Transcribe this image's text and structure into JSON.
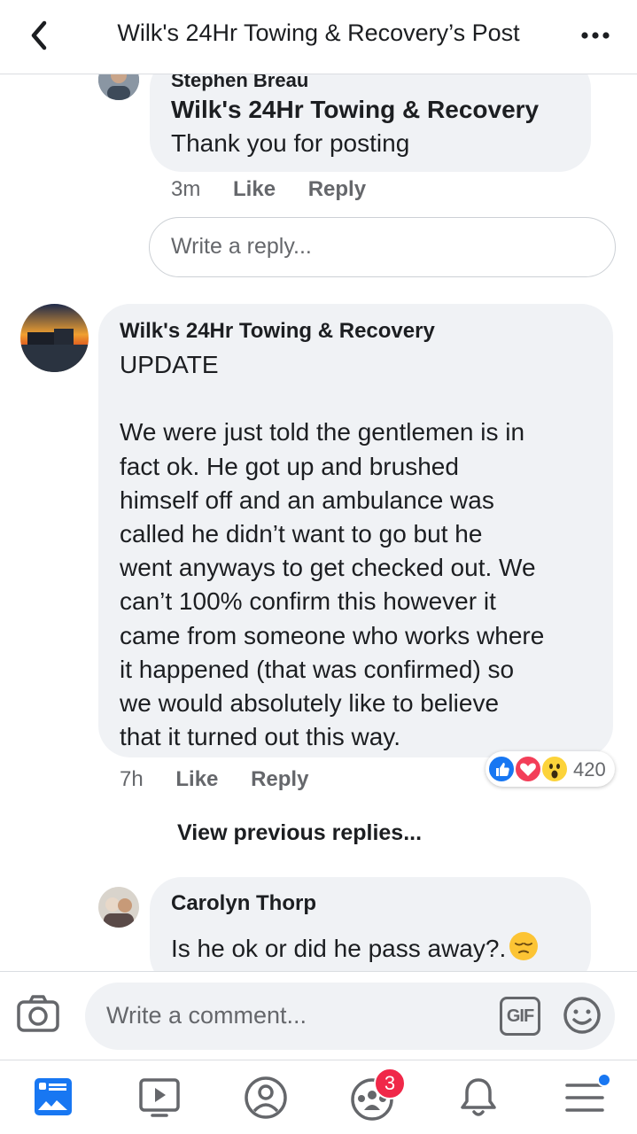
{
  "header": {
    "title": "Wilk's 24Hr Towing & Recovery’s Post",
    "back_icon": "chevron-left-icon",
    "more_icon": "more-horizontal-icon"
  },
  "comments": [
    {
      "author": "Stephen Breau",
      "mention": "Wilk's 24Hr Towing & Recovery",
      "text": "Thank you for posting",
      "time": "3m",
      "like_label": "Like",
      "reply_label": "Reply"
    },
    {
      "author": "Wilk's 24Hr Towing & Recovery",
      "text_lines": [
        "UPDATE",
        "",
        "We were just told the gentlemen is in",
        "fact ok. He got up and brushed",
        "himself off and an ambulance was",
        "called he didn’t want to go but he",
        "went anyways to get checked out. We",
        "can’t 100% confirm this however it",
        "came from someone who works where",
        "it happened (that was confirmed) so",
        "we would absolutely like to believe",
        "that it turned out this way."
      ],
      "time": "7h",
      "like_label": "Like",
      "reply_label": "Reply",
      "reactions": {
        "icons": [
          "like-reaction-icon",
          "love-reaction-icon",
          "wow-reaction-icon"
        ],
        "count": "420"
      }
    },
    {
      "author": "Carolyn Thorp",
      "text": "Is he ok or did he pass away?.",
      "emoji": "pensive-face-emoji"
    }
  ],
  "reply_input": {
    "placeholder": "Write a reply..."
  },
  "view_previous": "View previous replies...",
  "composer": {
    "placeholder": "Write a comment...",
    "gif_label": "GIF",
    "camera_icon": "camera-icon",
    "emoji_icon": "smiley-icon"
  },
  "tabbar": {
    "tabs": [
      "news-feed-icon",
      "watch-icon",
      "profile-icon",
      "groups-icon",
      "notifications-icon",
      "menu-icon"
    ],
    "groups_badge": "3"
  },
  "colors": {
    "accent": "#1877f2",
    "badge": "#f02849",
    "bubble": "#f0f2f5",
    "secondary_text": "#65676b"
  }
}
